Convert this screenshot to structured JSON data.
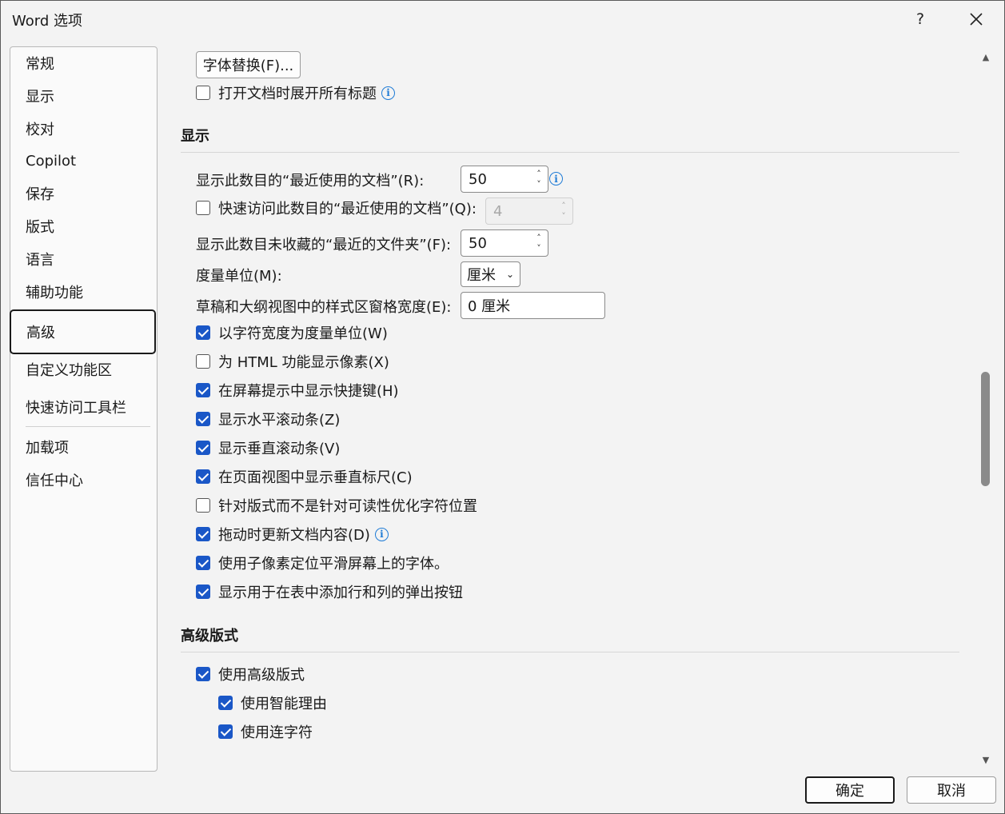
{
  "window": {
    "title": "Word 选项",
    "help": "?",
    "close": "✕"
  },
  "nav": {
    "items": [
      "常规",
      "显示",
      "校对",
      "Copilot",
      "保存",
      "版式",
      "语言",
      "辅助功能",
      "高级",
      "自定义功能区",
      "快速访问工具栏",
      "加载项",
      "信任中心"
    ],
    "selected": "高级"
  },
  "top": {
    "font_subst_button": "字体替换(F)...",
    "expand_headings": {
      "label": "打开文档时展开所有标题",
      "checked": false
    }
  },
  "display": {
    "heading": "显示",
    "recent_docs": {
      "label": "显示此数目的“最近使用的文档”(R):",
      "value": "50"
    },
    "quick_access_recent": {
      "label": "快速访问此数目的“最近使用的文档”(Q):",
      "value": "4",
      "checked": false
    },
    "recent_folders": {
      "label": "显示此数目未收藏的“最近的文件夹”(F):",
      "value": "50"
    },
    "units": {
      "label": "度量单位(M):",
      "value": "厘米"
    },
    "style_pane_width": {
      "label": "草稿和大纲视图中的样式区窗格宽度(E):",
      "value": "0 厘米"
    },
    "options": [
      {
        "label": "以字符宽度为度量单位(W)",
        "checked": true
      },
      {
        "label": "为 HTML 功能显示像素(X)",
        "checked": false
      },
      {
        "label": "在屏幕提示中显示快捷键(H)",
        "checked": true
      },
      {
        "label": "显示水平滚动条(Z)",
        "checked": true
      },
      {
        "label": "显示垂直滚动条(V)",
        "checked": true
      },
      {
        "label": "在页面视图中显示垂直标尺(C)",
        "checked": true
      },
      {
        "label": "针对版式而不是针对可读性优化字符位置",
        "checked": false
      },
      {
        "label": "拖动时更新文档内容(D)",
        "checked": true
      },
      {
        "label": "使用子像素定位平滑屏幕上的字体。",
        "checked": true
      },
      {
        "label": "显示用于在表中添加行和列的弹出按钮",
        "checked": true
      }
    ]
  },
  "advanced_layout": {
    "heading": "高级版式",
    "use_advanced": {
      "label": "使用高级版式",
      "checked": true
    },
    "smart_justify": {
      "label": "使用智能理由",
      "checked": true
    },
    "hyphen": {
      "label": "使用连字符",
      "checked": true
    }
  },
  "footer": {
    "ok": "确定",
    "cancel": "取消"
  }
}
